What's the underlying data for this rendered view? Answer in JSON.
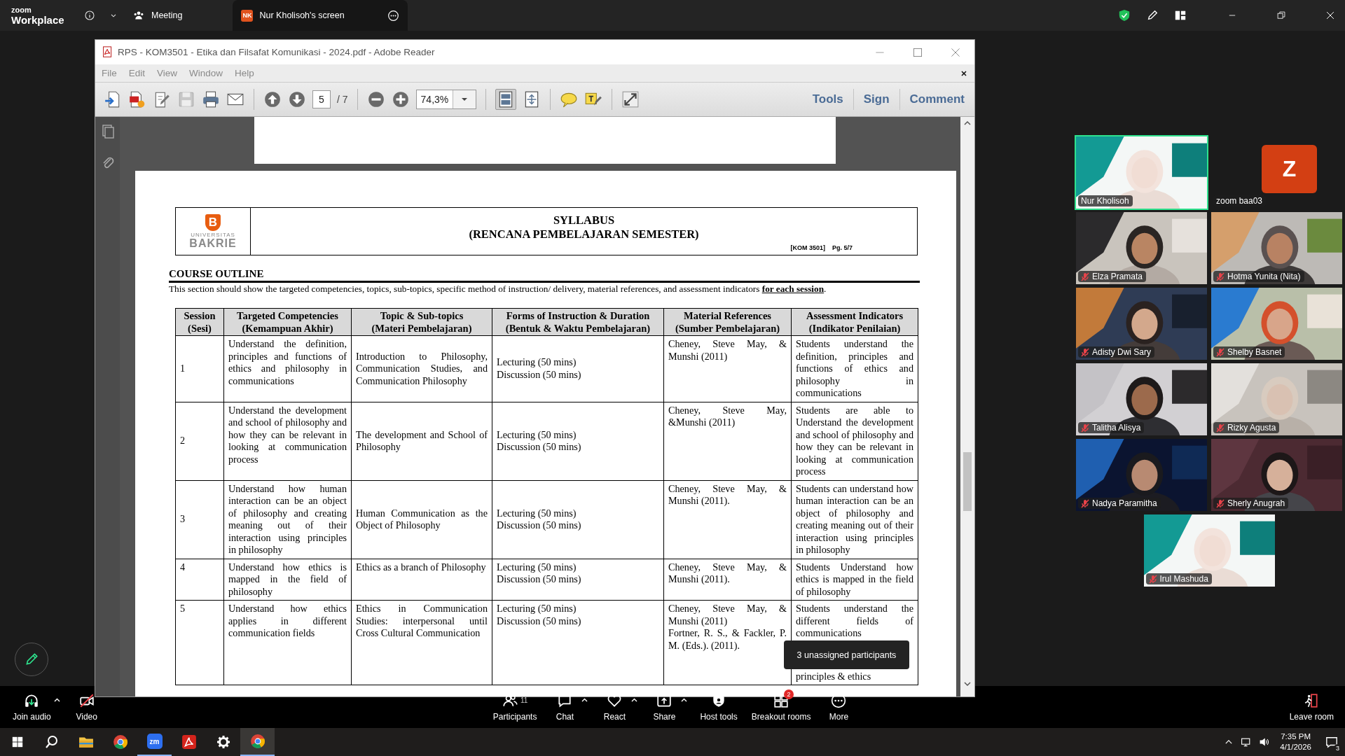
{
  "zoom_bar": {
    "brand_small": "zoom",
    "brand": "Workplace",
    "meeting_label": "Meeting",
    "share_tab": {
      "initials": "NK",
      "label": "Nur Kholisoh's screen"
    }
  },
  "reader": {
    "title": "RPS - KOM3501 - Etika dan Filsafat Komunikasi - 2024.pdf - Adobe Reader",
    "menu": [
      "File",
      "Edit",
      "View",
      "Window",
      "Help"
    ],
    "page": "5",
    "page_total": "/ 7",
    "zoom": "74,3%",
    "panes": [
      "Tools",
      "Sign",
      "Comment"
    ]
  },
  "document": {
    "logo_mark": "B",
    "logo_top": "UNIVERSITAS",
    "logo_name": "BAKRIE",
    "title": "SYLLABUS",
    "subtitle": "(RENCANA PEMBELAJARAN SEMESTER)",
    "code": "[KOM 3501]",
    "page_ref": "Pg. 5/7",
    "section": "COURSE OUTLINE",
    "intro": "This section should show the targeted competencies, topics, sub-topics, specific method of instruction/ delivery, material references, and assessment indicators **for each session**.",
    "table": {
      "columns": [
        {
          "title": "Session",
          "subtitle": "(Sesi)"
        },
        {
          "title": "Targeted Competencies",
          "subtitle": "(Kemampuan Akhir)"
        },
        {
          "title": "Topic & Sub-topics",
          "subtitle": "(Materi Pembelajaran)"
        },
        {
          "title": "Forms of Instruction & Duration",
          "subtitle": "(Bentuk & Waktu Pembelajaran)"
        },
        {
          "title": "Material References",
          "subtitle": "(Sumber Pembelajaran)"
        },
        {
          "title": "Assessment Indicators",
          "subtitle": "(Indikator Penilaian)"
        }
      ],
      "rows": [
        {
          "centered": true,
          "cells": [
            [
              "1"
            ],
            [
              "Understand the definition, principles and functions of ethics and philosophy in communications"
            ],
            [
              "Introduction to Philosophy, Communication Studies, and Communication Philosophy"
            ],
            [
              "Lecturing (50 mins)",
              "Discussion (50 mins)"
            ],
            [
              "Cheney, Steve May, & Munshi (2011)"
            ],
            [
              "Students understand the definition, principles and functions of ethics and philosophy in communications"
            ]
          ]
        },
        {
          "centered": true,
          "cells": [
            [
              "2"
            ],
            [
              "Understand the development and school of philosophy and how they can be relevant in looking at communication process"
            ],
            [
              "The development and School of Philosophy"
            ],
            [
              "Lecturing (50 mins)",
              "Discussion (50 mins)"
            ],
            [
              "Cheney, Steve May, &Munshi (2011)"
            ],
            [
              "Students are able to Understand the development and school of philosophy and how they can be relevant in looking at communication process"
            ]
          ]
        },
        {
          "centered": true,
          "cells": [
            [
              "3"
            ],
            [
              "Understand how human interaction can be an object of philosophy and creating meaning out of their interaction using principles in philosophy"
            ],
            [
              "Human Communication as the Object of Philosophy"
            ],
            [
              "Lecturing (50 mins)",
              "Discussion (50 mins)"
            ],
            [
              "Cheney, Steve May, & Munshi (2011)."
            ],
            [
              "Students can understand how human interaction can be an object of philosophy and creating meaning out of their interaction using principles in philosophy"
            ]
          ]
        },
        {
          "centered": false,
          "cells": [
            [
              "4"
            ],
            [
              "Understand how ethics is mapped in the field of philosophy"
            ],
            [
              "Ethics as a branch of Philosophy"
            ],
            [
              "Lecturing (50 mins)",
              "Discussion (50 mins)"
            ],
            [
              "Cheney, Steve May, & Munshi (2011)."
            ],
            [
              "Students Understand how ethics is mapped in the field of philosophy"
            ]
          ]
        },
        {
          "centered": false,
          "cells": [
            [
              "5"
            ],
            [
              "Understand how ethics applies in different communication fields"
            ],
            [
              "Ethics in Communication Studies: interpersonal until Cross Cultural Communication"
            ],
            [
              "Lecturing (50 mins)",
              "Discussion (50 mins)"
            ],
            [
              "Cheney, Steve May, & Munshi (2011)",
              "Fortner, R. S., & Fackler, P. M. (Eds.). (2011)."
            ],
            [
              "Students understand the different fields of communications",
              "principles & ethics"
            ]
          ]
        }
      ]
    }
  },
  "participants": [
    {
      "name": "Nur Kholisoh",
      "kind": "video",
      "muted": false,
      "speaking": true
    },
    {
      "name": "zoom baa03",
      "kind": "avatar",
      "initial": "Z",
      "muted": false,
      "speaking": false
    },
    {
      "name": "Elza Pramata",
      "kind": "video",
      "muted": true,
      "speaking": false
    },
    {
      "name": "Hotma Yunita (Nita)",
      "kind": "video",
      "muted": true,
      "speaking": false
    },
    {
      "name": "Adisty Dwi Sary",
      "kind": "video",
      "muted": true,
      "speaking": false
    },
    {
      "name": "Shelby Basnet",
      "kind": "video",
      "muted": true,
      "speaking": false
    },
    {
      "name": "Talitha Alisya",
      "kind": "video",
      "muted": true,
      "speaking": false
    },
    {
      "name": "Rizky Agusta",
      "kind": "video",
      "muted": true,
      "speaking": false
    },
    {
      "name": "Nadya Paramitha",
      "kind": "video",
      "muted": true,
      "speaking": false
    },
    {
      "name": "Sherly Anugrah",
      "kind": "video",
      "muted": true,
      "speaking": false
    },
    {
      "name": "Irul Mashuda",
      "kind": "video",
      "muted": true,
      "speaking": false
    }
  ],
  "tooltip": "3 unassigned participants",
  "toolbar": {
    "left": [
      {
        "kind": "audio",
        "label": "Join audio",
        "caret": true
      },
      {
        "kind": "video",
        "label": "Video",
        "caret": false
      }
    ],
    "center": [
      {
        "kind": "participants",
        "label": "Participants",
        "count": "11",
        "caret": false
      },
      {
        "kind": "chat",
        "label": "Chat",
        "caret": true
      },
      {
        "kind": "react",
        "label": "React",
        "caret": true
      },
      {
        "kind": "share",
        "label": "Share",
        "caret": true
      },
      {
        "kind": "host",
        "label": "Host tools",
        "caret": false
      },
      {
        "kind": "breakout",
        "label": "Breakout rooms",
        "badge": "2",
        "caret": false
      },
      {
        "kind": "more",
        "label": "More",
        "caret": false
      }
    ],
    "right": [
      {
        "kind": "leave",
        "label": "Leave room",
        "caret": false
      }
    ]
  },
  "taskbar": {
    "apps": [
      {
        "kind": "start",
        "running": false,
        "selected": false
      },
      {
        "kind": "search",
        "running": false,
        "selected": false
      },
      {
        "kind": "explorer",
        "running": false,
        "selected": false
      },
      {
        "kind": "browser",
        "running": false,
        "selected": false
      },
      {
        "kind": "zoom",
        "text": "zm",
        "running": true,
        "selected": false
      },
      {
        "kind": "pdf",
        "running": false,
        "selected": false
      },
      {
        "kind": "settings",
        "running": false,
        "selected": false
      },
      {
        "kind": "browser-profile",
        "running": true,
        "selected": true
      }
    ],
    "time": "7:35 PM",
    "date": "4/1/2026",
    "notifications": "3"
  }
}
